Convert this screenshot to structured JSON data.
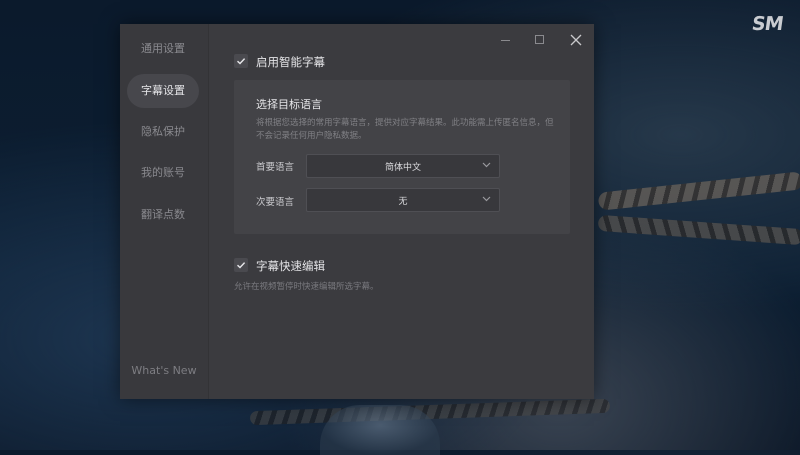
{
  "background": {
    "brand_logo_text": "SM"
  },
  "sidebar": {
    "items": [
      {
        "label": "通用设置",
        "active": false
      },
      {
        "label": "字幕设置",
        "active": true
      },
      {
        "label": "隐私保护",
        "active": false
      },
      {
        "label": "我的账号",
        "active": false
      },
      {
        "label": "翻译点数",
        "active": false
      }
    ],
    "whats_new": "What's New"
  },
  "window_controls": {
    "minimize": "minimize-icon",
    "maximize": "maximize-icon",
    "close": "close-icon"
  },
  "smart_subtitle": {
    "label": "启用智能字幕",
    "checked": true
  },
  "target_language": {
    "title": "选择目标语言",
    "description": "将根据您选择的常用字幕语言，提供对应字幕结果。此功能需上传匿名信息，但不会记录任何用户隐私数据。",
    "primary_label": "首要语言",
    "primary_value": "简体中文",
    "secondary_label": "次要语言",
    "secondary_value": "无"
  },
  "quick_edit": {
    "label": "字幕快速编辑",
    "checked": true,
    "description": "允许在视频暂停时快速编辑所选字幕。"
  },
  "colors": {
    "dialog_bg": "#3b3b3f",
    "sidebar_bg": "#39393d",
    "panel_bg": "#434347",
    "active_nav_bg": "#47474c"
  }
}
